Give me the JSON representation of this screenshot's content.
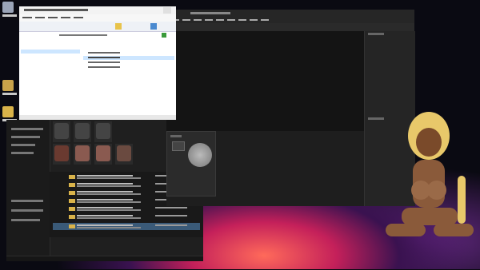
{
  "desktop": {
    "icons": [
      {
        "label": ""
      },
      {
        "label": ""
      },
      {
        "label": ""
      }
    ]
  },
  "archiver": {
    "title": "",
    "menu": [
      "",
      "",
      "",
      "",
      ""
    ],
    "address": "",
    "tree": [
      ""
    ],
    "files": [
      {
        "name": "",
        "size": "",
        "type": ""
      },
      {
        "name": "",
        "size": "",
        "type": ""
      },
      {
        "name": "",
        "size": "",
        "type": ""
      },
      {
        "name": "",
        "size": "",
        "type": ""
      }
    ],
    "status": ""
  },
  "explorer": {
    "sidebar": [
      "",
      "",
      "",
      "",
      "",
      "",
      ""
    ],
    "thumbnails": [
      {
        "label": ""
      },
      {
        "label": ""
      },
      {
        "label": ""
      },
      {
        "label": ""
      },
      {
        "label": ""
      },
      {
        "label": ""
      },
      {
        "label": ""
      }
    ],
    "files": [
      {
        "name": "",
        "path": "",
        "date": ""
      },
      {
        "name": "",
        "path": "",
        "date": ""
      },
      {
        "name": "",
        "path": "",
        "date": ""
      },
      {
        "name": "",
        "path": "",
        "date": ""
      },
      {
        "name": "",
        "path": "",
        "date": ""
      },
      {
        "name": "",
        "path": "",
        "date": ""
      },
      {
        "name": "",
        "path": "",
        "date": ""
      }
    ],
    "status": ""
  },
  "paint_app": {
    "title": "",
    "menu": [
      "",
      "",
      "",
      "",
      "",
      "",
      "",
      "",
      ""
    ],
    "panels": {
      "top_label": "",
      "bottom_label": ""
    }
  },
  "color_panel": {
    "title": ""
  },
  "colors": {
    "accent": "#3a5a78",
    "highlight": "#ffe600",
    "selection": "#cde6ff"
  }
}
